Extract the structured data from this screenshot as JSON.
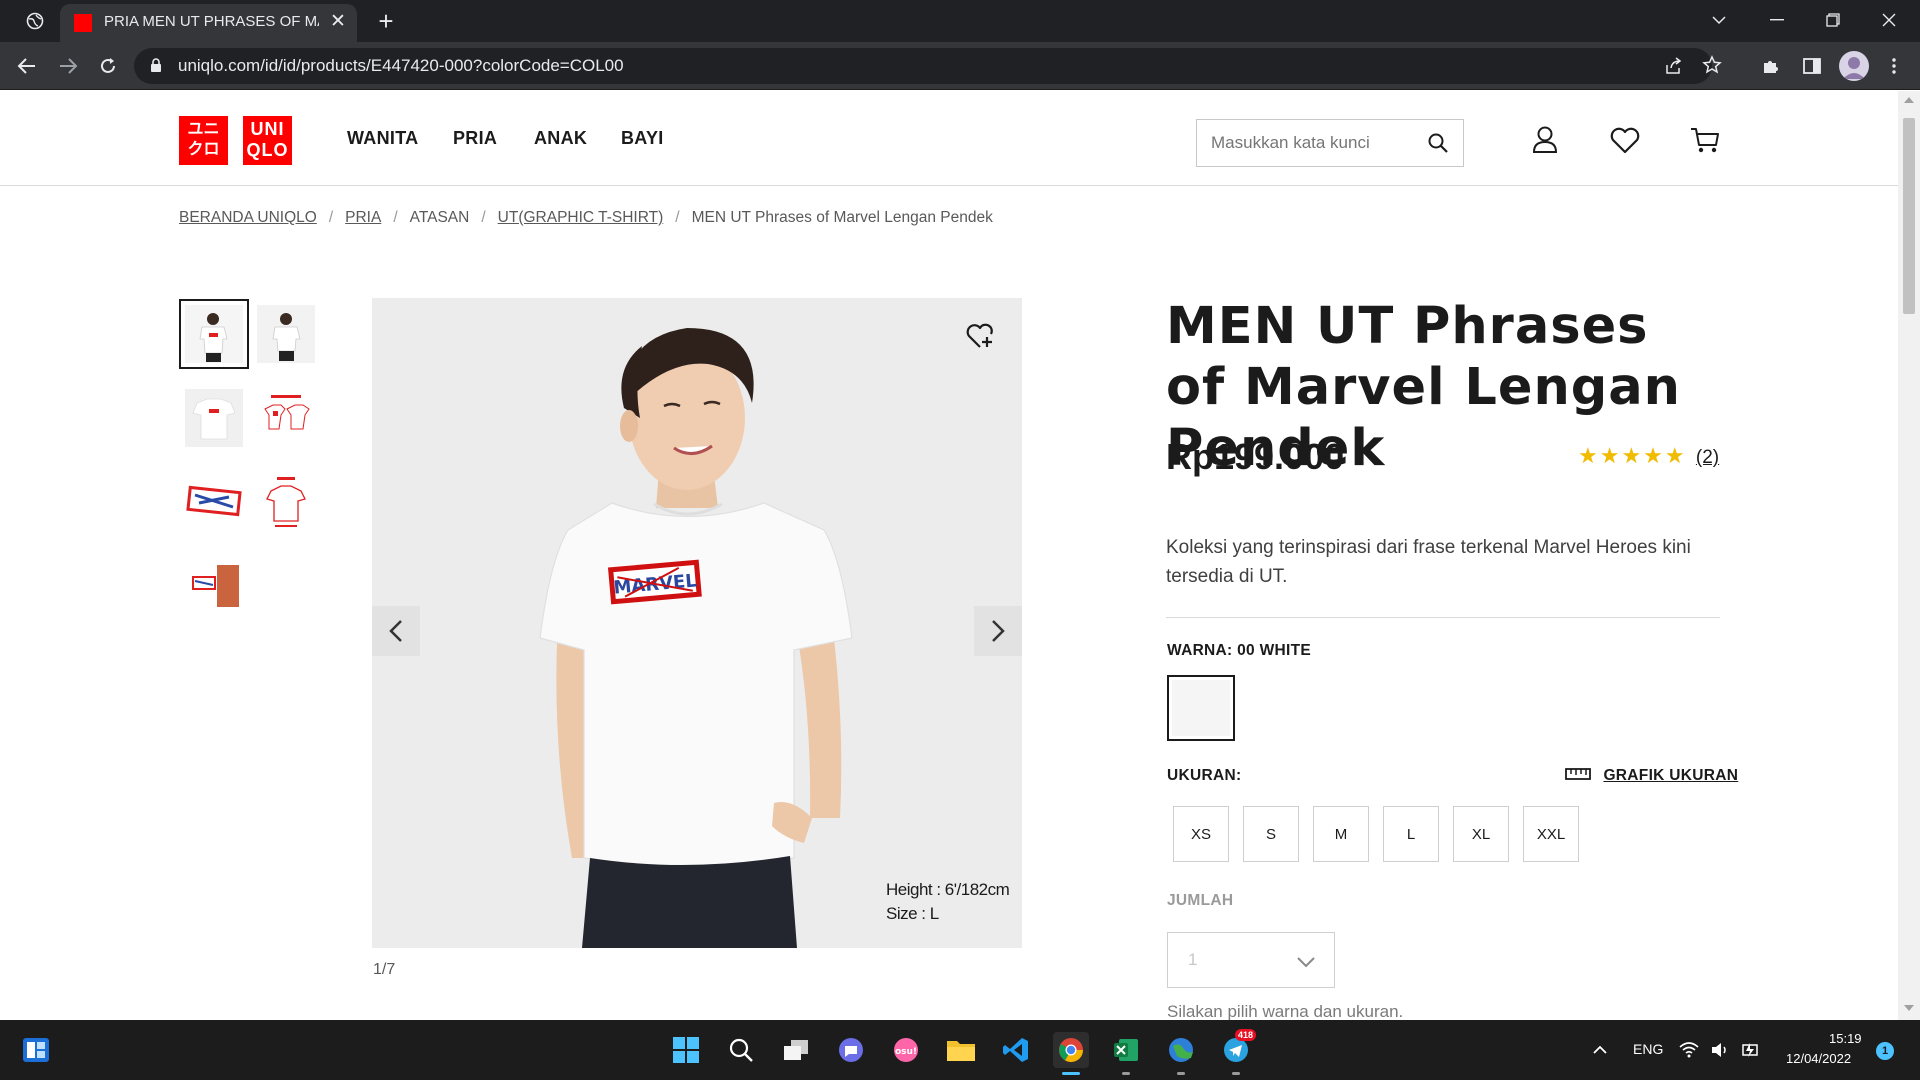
{
  "browser": {
    "tab_title": "PRIA MEN UT PHRASES OF MAR",
    "url": "uniqlo.com/id/id/products/E447420-000?colorCode=COL00"
  },
  "site": {
    "logo_top": "UNI",
    "logo_bottom": "QLO",
    "logo_katakana_top": "ユニ",
    "logo_katakana_bottom": "クロ",
    "nav": [
      "WANITA",
      "PRIA",
      "ANAK",
      "BAYI"
    ],
    "search_placeholder": "Masukkan kata kunci"
  },
  "breadcrumb": {
    "items": [
      "BERANDA UNIQLO",
      "PRIA",
      "ATASAN",
      "UT(GRAPHIC T-SHIRT)",
      "MEN UT Phrases of Marvel Lengan Pendek"
    ],
    "separator": "/"
  },
  "gallery": {
    "image_caption_height": "Height : 6'/182cm",
    "image_caption_size": "Size : L",
    "counter": "1/7",
    "shirt_graphic_text": "MARVEL"
  },
  "product": {
    "title": "MEN UT Phrases of Marvel Lengan Pendek",
    "price": "Rp199.000",
    "stars": "★★★★★",
    "rating_count": "(2)",
    "rating_value": 5,
    "description": "Koleksi yang terinspirasi dari frase terkenal Marvel Heroes kini tersedia di UT.",
    "color_label": "WARNA: 00 WHITE",
    "size_label": "UKURAN:",
    "size_chart_link": "GRAFIK UKURAN",
    "sizes": [
      "XS",
      "S",
      "M",
      "L",
      "XL",
      "XXL"
    ],
    "quantity_label": "JUMLAH",
    "quantity_value": "1",
    "helper_text": "Silakan pilih warna dan ukuran."
  },
  "taskbar": {
    "language": "ENG",
    "time": "15:19",
    "date": "12/04/2022",
    "telegram_badge": "418",
    "notification_count": "1"
  },
  "colors": {
    "uniqlo_red": "#ff0000",
    "star_yellow": "#f1bb00",
    "chrome_dark": "#202124",
    "chrome_toolbar": "#35363a"
  }
}
